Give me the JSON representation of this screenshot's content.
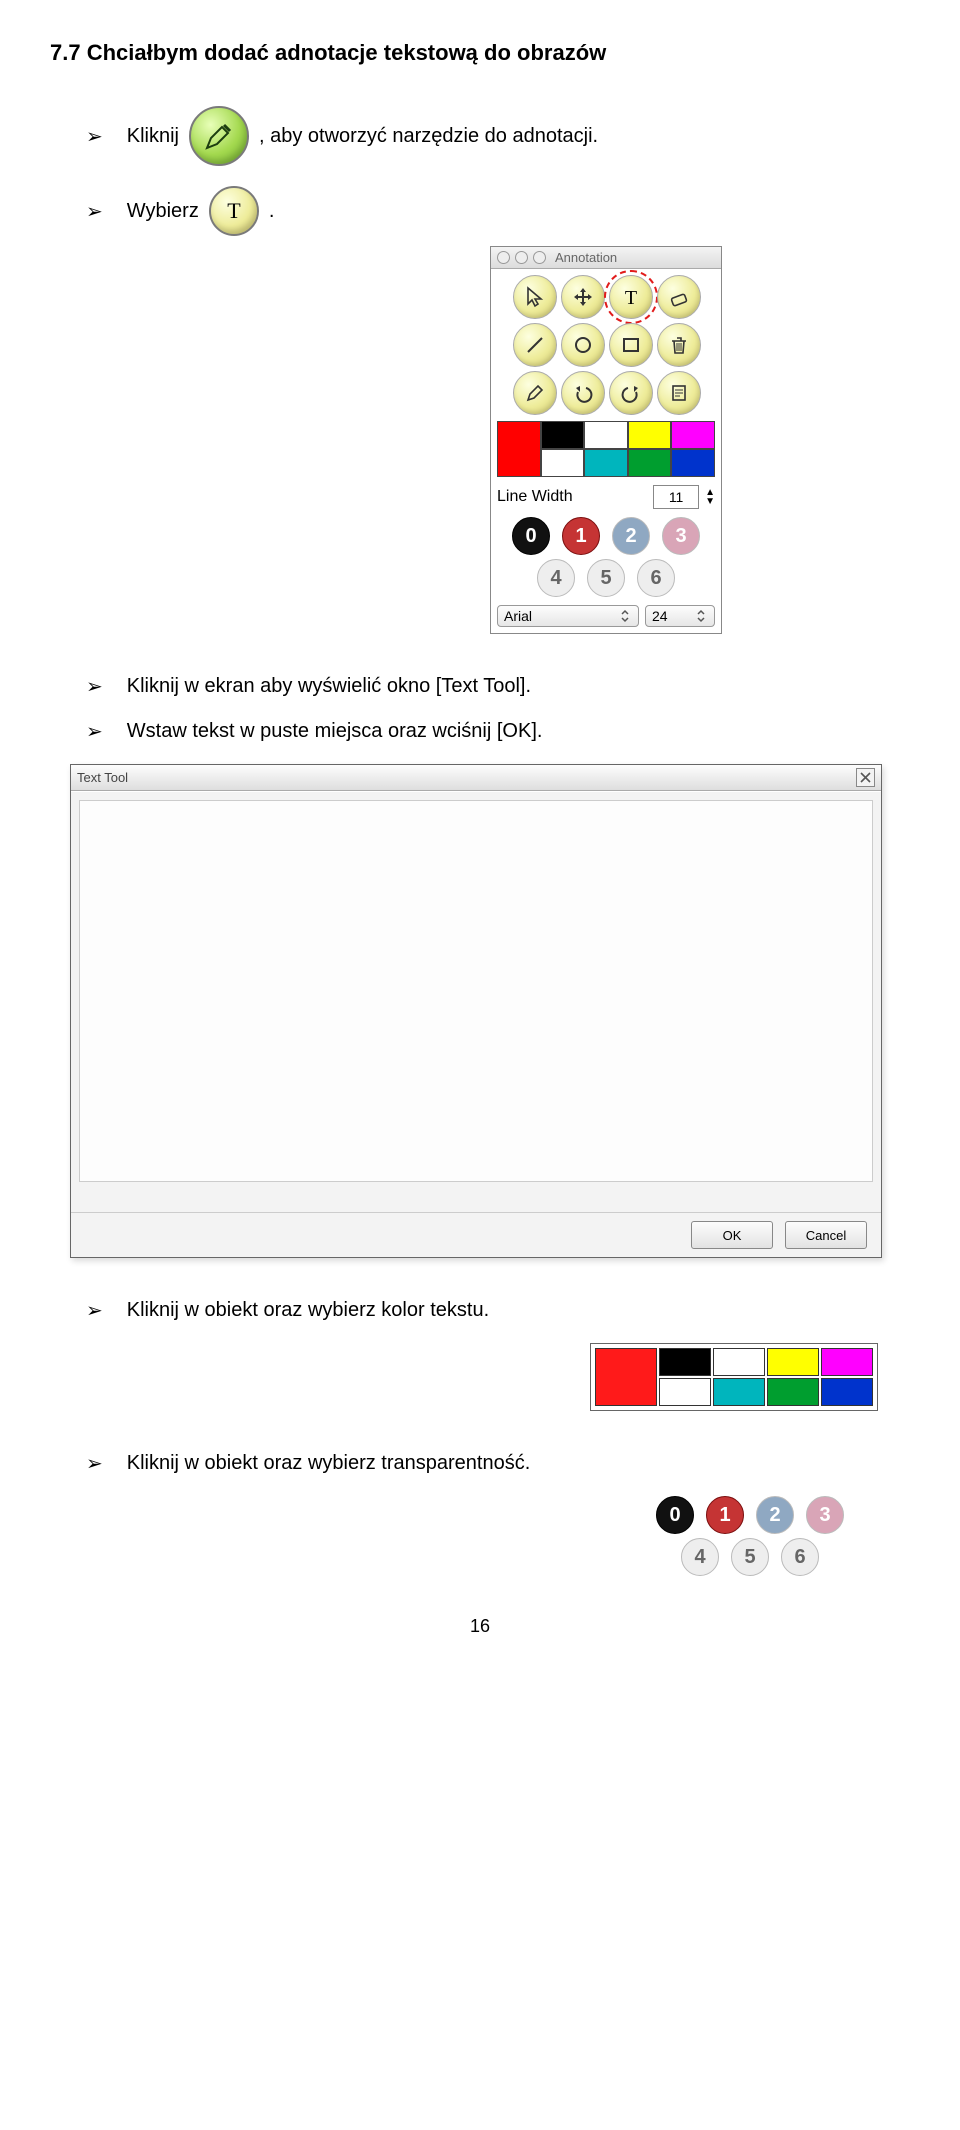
{
  "heading": "7.7   Chciałbym dodać adnotacje tekstową do obrazów",
  "bullets": {
    "b1_pre": "Kliknij",
    "b1_post": ", aby otworzyć narzędzie do adnotacji.",
    "b2_pre": "Wybierz",
    "b2_post": ".",
    "b3": "Kliknij w ekran aby wyświelić okno [Text Tool].",
    "b4": "Wstaw tekst w puste miejsca oraz wciśnij [OK].",
    "b5": "Kliknij w obiekt oraz wybierz kolor tekstu.",
    "b6": "Kliknij w obiekt oraz wybierz transparentność."
  },
  "palette": {
    "title": "Annotation",
    "tools": [
      "cursor-icon",
      "move-icon",
      "text-icon",
      "eraser-icon",
      "line-icon",
      "ellipse-icon",
      "rectangle-icon",
      "trash-icon",
      "pencil-icon",
      "undo-icon",
      "redo-icon",
      "note-icon"
    ],
    "colors_row1": [
      "#000000",
      "#ffff00",
      "#ff00ff"
    ],
    "colors_row2": [
      "#ffffff",
      "#00b5bd",
      "#009e2f",
      "#0033cc"
    ],
    "big_color": "#ff0000",
    "line_width_label": "Line Width",
    "line_width_value": "11",
    "opacity_row1": [
      "0",
      "1",
      "2",
      "3"
    ],
    "opacity_row2": [
      "4",
      "5",
      "6"
    ],
    "font_name": "Arial",
    "font_size": "24"
  },
  "dialog": {
    "title": "Text Tool",
    "ok_label": "OK",
    "cancel_label": "Cancel"
  },
  "swatch_panel": {
    "big": "#ff1a1a",
    "row1": [
      "#000000",
      "#ffff00",
      "#ff00ff"
    ],
    "row2": [
      "#ffffff",
      "#00b5bd",
      "#009e2f",
      "#0033cc"
    ]
  },
  "opacity_panel": {
    "row1": [
      "0",
      "1",
      "2",
      "3"
    ],
    "row2": [
      "4",
      "5",
      "6"
    ]
  },
  "page_number": "16"
}
